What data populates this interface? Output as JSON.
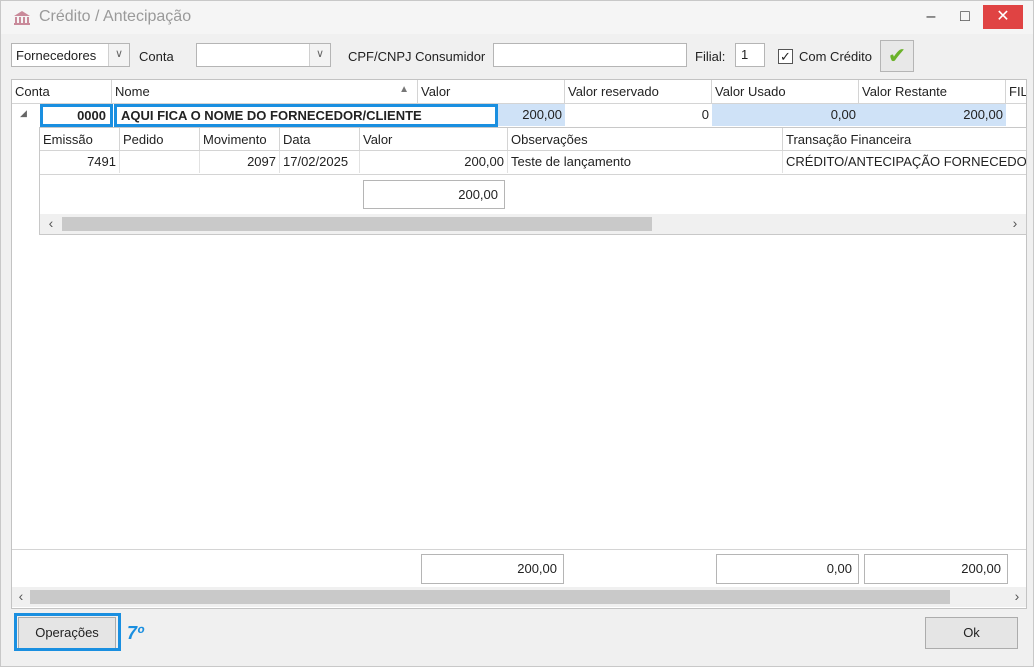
{
  "window": {
    "title": "Crédito / Antecipação",
    "minimize": "–",
    "maximize": "□",
    "close": "✕"
  },
  "toolbar": {
    "type_select": "Fornecedores",
    "conta_label": "Conta",
    "conta_value": "",
    "cpf_label": "CPF/CNPJ Consumidor",
    "cpf_value": "",
    "filial_label": "Filial:",
    "filial_value": "1",
    "com_credito_label": "Com Crédito",
    "com_credito_checked": "✓",
    "confirm_icon": "✔"
  },
  "grid": {
    "columns": [
      "Conta",
      "Nome",
      "Valor",
      "Valor reservado",
      "Valor Usado",
      "Valor Restante",
      "FIL"
    ],
    "row": {
      "expander": "◢",
      "conta": "0000",
      "nome": "AQUI FICA O NOME DO FORNECEDOR/CLIENTE",
      "valor": "200,00",
      "valor_reservado": "0",
      "valor_usado": "0,00",
      "valor_restante": "200,00"
    },
    "detail": {
      "columns": [
        "Emissão",
        "Pedido",
        "Movimento",
        "Data",
        "Valor",
        "Observações",
        "Transação Financeira"
      ],
      "rows": [
        {
          "emissao": "7491",
          "pedido": "",
          "movimento": "2097",
          "data": "17/02/2025",
          "valor": "200,00",
          "observacoes": "Teste de lançamento",
          "transacao": "CRÉDITO/ANTECIPAÇÃO FORNECEDOR"
        }
      ],
      "total_valor": "200,00"
    },
    "totals": {
      "valor": "200,00",
      "valor_usado": "0,00",
      "valor_restante": "200,00"
    }
  },
  "footer": {
    "operacoes_label": "Operações",
    "ok_label": "Ok",
    "step_annotation": "7º"
  },
  "colors": {
    "highlight": "#1a8fe0",
    "selected_row": "#cfe2f7",
    "close_button": "#e04343"
  }
}
